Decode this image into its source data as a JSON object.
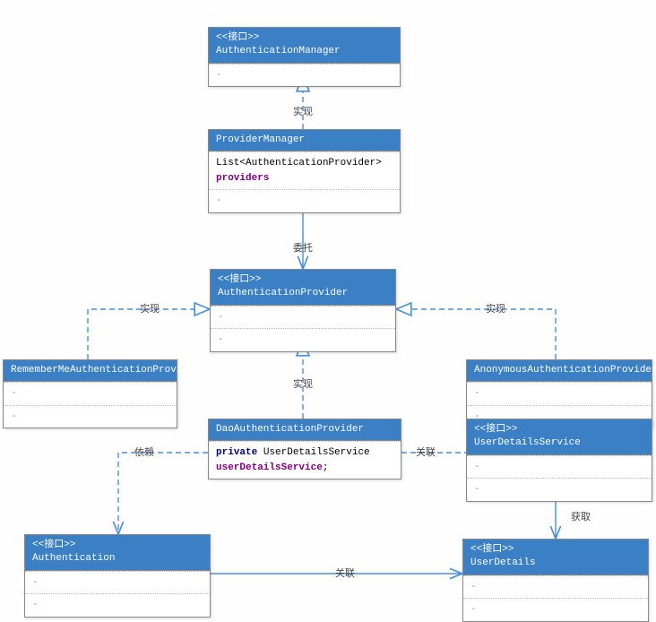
{
  "stereotype": "<<接口>>",
  "boxes": {
    "authManager": {
      "stereo": true,
      "title": "AuthenticationManager"
    },
    "providerManager": {
      "stereo": false,
      "title": "ProviderManager",
      "line1a": "List<AuthenticationProvider>",
      "line1b": "providers"
    },
    "authProvider": {
      "stereo": true,
      "title": "AuthenticationProvider"
    },
    "rememberMe": {
      "stereo": false,
      "title": "RememberMeAuthenticationProvider"
    },
    "anonymous": {
      "stereo": false,
      "title": "AnonymousAuthenticationProvider"
    },
    "daoAuth": {
      "stereo": false,
      "title": "DaoAuthenticationProvider",
      "line_kw": "private",
      "line_type": "UserDetailsService",
      "line_attr": "userDetailsService"
    },
    "userDetailsService": {
      "stereo": true,
      "title": "UserDetailsService"
    },
    "authentication": {
      "stereo": true,
      "title": "Authentication"
    },
    "userDetails": {
      "stereo": true,
      "title": "UserDetails"
    }
  },
  "labels": {
    "realize": "实现",
    "delegate": "委托",
    "depend": "依赖",
    "assoc": "关联",
    "obtain": "获取"
  }
}
